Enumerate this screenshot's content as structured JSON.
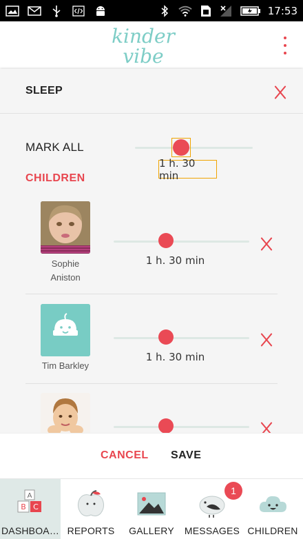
{
  "status_bar": {
    "time": "17:53",
    "icons": [
      "gallery-icon",
      "mail-icon",
      "usb-icon",
      "code-icon",
      "android-icon",
      "bluetooth-icon",
      "wifi-icon",
      "sim-icon",
      "no-signal-icon",
      "battery-icon"
    ]
  },
  "app": {
    "logo_line1": "kinder",
    "logo_line2": "vibe",
    "brand_color": "#7dcdc6",
    "accent_color": "#e8464f"
  },
  "dialog": {
    "title": "SLEEP",
    "mark_all_label": "MARK ALL",
    "mark_all_value": "1 h. 30 min",
    "children_label": "CHILDREN",
    "children": [
      {
        "name_line1": "Sophie",
        "name_line2": "Aniston",
        "value": "1 h. 30 min",
        "photo": "photo-girl"
      },
      {
        "name_line1": "Tim Barkley",
        "name_line2": "",
        "value": "1 h. 30 min",
        "photo": "placeholder-avatar"
      },
      {
        "name_line1": "",
        "name_line2": "",
        "value": "",
        "photo": "photo-boy"
      }
    ]
  },
  "actions": {
    "cancel": "CANCEL",
    "save": "SAVE"
  },
  "bottom_nav": {
    "items": [
      {
        "label": "DASHBOA…",
        "icon": "blocks-icon"
      },
      {
        "label": "REPORTS",
        "icon": "apple-icon"
      },
      {
        "label": "GALLERY",
        "icon": "picture-icon"
      },
      {
        "label": "MESSAGES",
        "icon": "bird-icon",
        "badge": "1"
      },
      {
        "label": "CHILDREN",
        "icon": "cloud-face-icon"
      }
    ]
  }
}
